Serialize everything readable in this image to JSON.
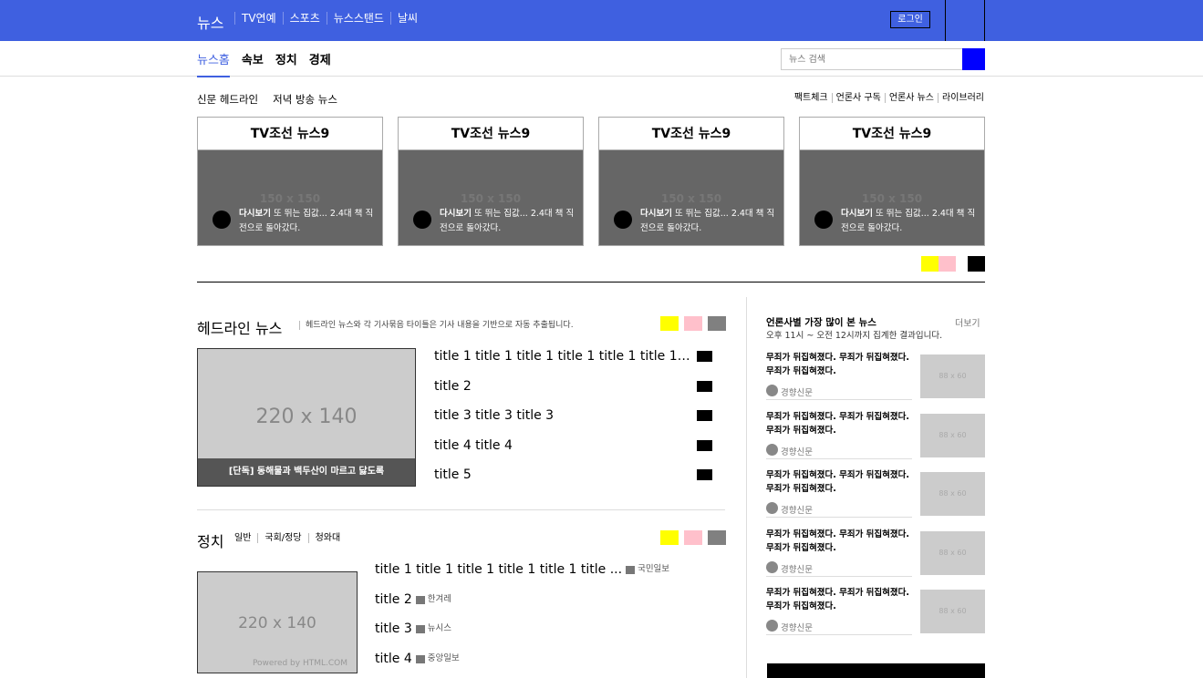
{
  "header": {
    "brand": "뉴스",
    "nav": [
      "TV연예",
      "스포츠",
      "뉴스스탠드",
      "날씨"
    ],
    "login": "로그인"
  },
  "subnav": {
    "tabs": [
      "뉴스홈",
      "속보",
      "정치",
      "경제"
    ],
    "search_placeholder": "뉴스 검색"
  },
  "papers": {
    "tabs": [
      "신문 헤드라인",
      "저녁 방송 뉴스"
    ],
    "links": [
      "팩트체크",
      "언론사 구독",
      "언론사 뉴스",
      "라이브러리"
    ],
    "cards": [
      {
        "title": "TV조선 뉴스9",
        "placeholder": "150 x 150",
        "label": "다시보기",
        "text": "또 뛰는 집값... 2.4대 책 직전으로 돌아갔다."
      },
      {
        "title": "TV조선 뉴스9",
        "placeholder": "150 x 150",
        "label": "다시보기",
        "text": "또 뛰는 집값... 2.4대 책 직전으로 돌아갔다."
      },
      {
        "title": "TV조선 뉴스9",
        "placeholder": "150 x 150",
        "label": "다시보기",
        "text": "또 뛰는 집값... 2.4대 책 직전으로 돌아갔다."
      },
      {
        "title": "TV조선 뉴스9",
        "placeholder": "150 x 150",
        "label": "다시보기",
        "text": "또 뛰는 집값... 2.4대 책 직전으로 돌아갔다."
      }
    ]
  },
  "headline": {
    "title": "헤드라인 뉴스",
    "desc": "헤드라인 뉴스와 각 기사묶음 타이틀은 기사 내용을 기반으로 자동 추출됩니다.",
    "image_placeholder": "220 x 140",
    "caption": "[단독] 동해물과 백두산이 마르고 닳도록",
    "items": [
      "title 1 title 1 title 1 title 1 title 1 title 1 title 1",
      "title 2",
      "title 3 title 3 title 3",
      "title 4 title 4",
      "title 5"
    ]
  },
  "politics": {
    "title": "정치",
    "subtabs": [
      "일반",
      "국회/정당",
      "청와대"
    ],
    "image_placeholder": "220 x 140",
    "powered": "Powered by HTML.COM",
    "items": [
      {
        "title": "title 1 title 1 title 1 title 1 title 1 title ...",
        "source": "국민일보"
      },
      {
        "title": "title 2",
        "source": "한겨레"
      },
      {
        "title": "title 3",
        "source": "뉴시스"
      },
      {
        "title": "title 4",
        "source": "중앙일보"
      }
    ]
  },
  "ranking": {
    "title": "언론사별 가장 많이 본 뉴스",
    "more": "더보기",
    "subtitle": "오후 11시 ~ 오전 12시까지 집계한 결과입니다.",
    "items": [
      {
        "text": "무죄가 뒤집혀졌다. 무죄가 뒤집혀졌다. 무죄가 뒤집혀졌다.",
        "source": "경향신문",
        "image": "88 x 60"
      },
      {
        "text": "무죄가 뒤집혀졌다. 무죄가 뒤집혀졌다. 무죄가 뒤집혀졌다.",
        "source": "경향신문",
        "image": "88 x 60"
      },
      {
        "text": "무죄가 뒤집혀졌다. 무죄가 뒤집혀졌다. 무죄가 뒤집혀졌다.",
        "source": "경향신문",
        "image": "88 x 60"
      },
      {
        "text": "무죄가 뒤집혀졌다. 무죄가 뒤집혀졌다. 무죄가 뒤집혀졌다.",
        "source": "경향신문",
        "image": "88 x 60"
      },
      {
        "text": "무죄가 뒤집혀졌다. 무죄가 뒤집혀졌다. 무죄가 뒤집혀졌다.",
        "source": "경향신문",
        "image": "88 x 60"
      }
    ]
  },
  "colors": {
    "accent": "#3f60e0",
    "yellow": "#ffff00",
    "pink": "#ffc0cb",
    "gray": "#808080",
    "search_button": "#0000ff"
  }
}
